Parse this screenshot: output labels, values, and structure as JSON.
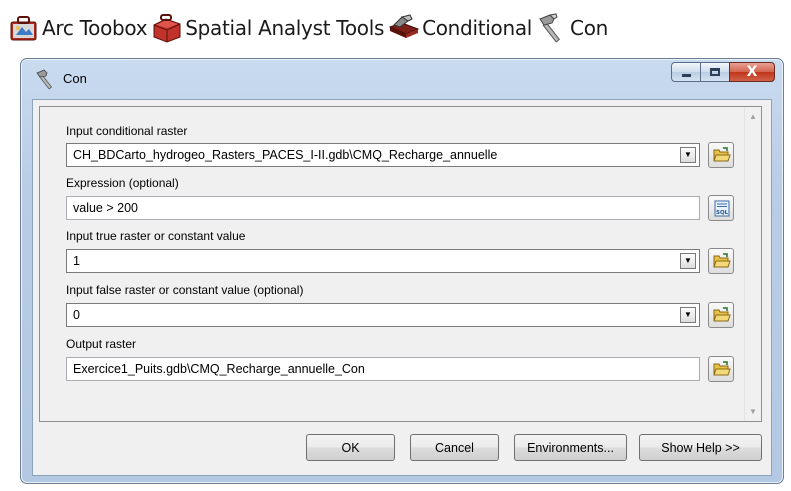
{
  "breadcrumb": {
    "items": [
      {
        "label": "Arc Toobox",
        "icon": "arctoolbox-icon"
      },
      {
        "label": "Spatial Analyst Tools",
        "icon": "toolbox-icon"
      },
      {
        "label": "Conditional",
        "icon": "toolset-icon"
      },
      {
        "label": "Con",
        "icon": "hammer-icon"
      }
    ]
  },
  "window": {
    "title": "Con",
    "title_icon": "hammer-icon",
    "controls": {
      "minimize": "minimize",
      "maximize": "maximize",
      "close": "X"
    }
  },
  "form": {
    "input_conditional_raster": {
      "label": "Input conditional raster",
      "value": "CH_BDCarto_hydrogeo_Rasters_PACES_I-II.gdb\\CMQ_Recharge_annuelle"
    },
    "expression": {
      "label": "Expression (optional)",
      "value": "value > 200"
    },
    "input_true": {
      "label": "Input true raster or constant value",
      "value": "1"
    },
    "input_false": {
      "label": "Input false raster or constant value (optional)",
      "value": "0"
    },
    "output_raster": {
      "label": "Output raster",
      "value": "Exercice1_Puits.gdb\\CMQ_Recharge_annuelle_Con"
    }
  },
  "buttons": {
    "ok": "OK",
    "cancel": "Cancel",
    "environments": "Environments...",
    "show_help": "Show Help >>"
  },
  "colors": {
    "window_frame": "#b9cde6",
    "close_button": "#c1341a",
    "client_bg": "#f0f0f0",
    "folder_yellow": "#e8c14a"
  }
}
